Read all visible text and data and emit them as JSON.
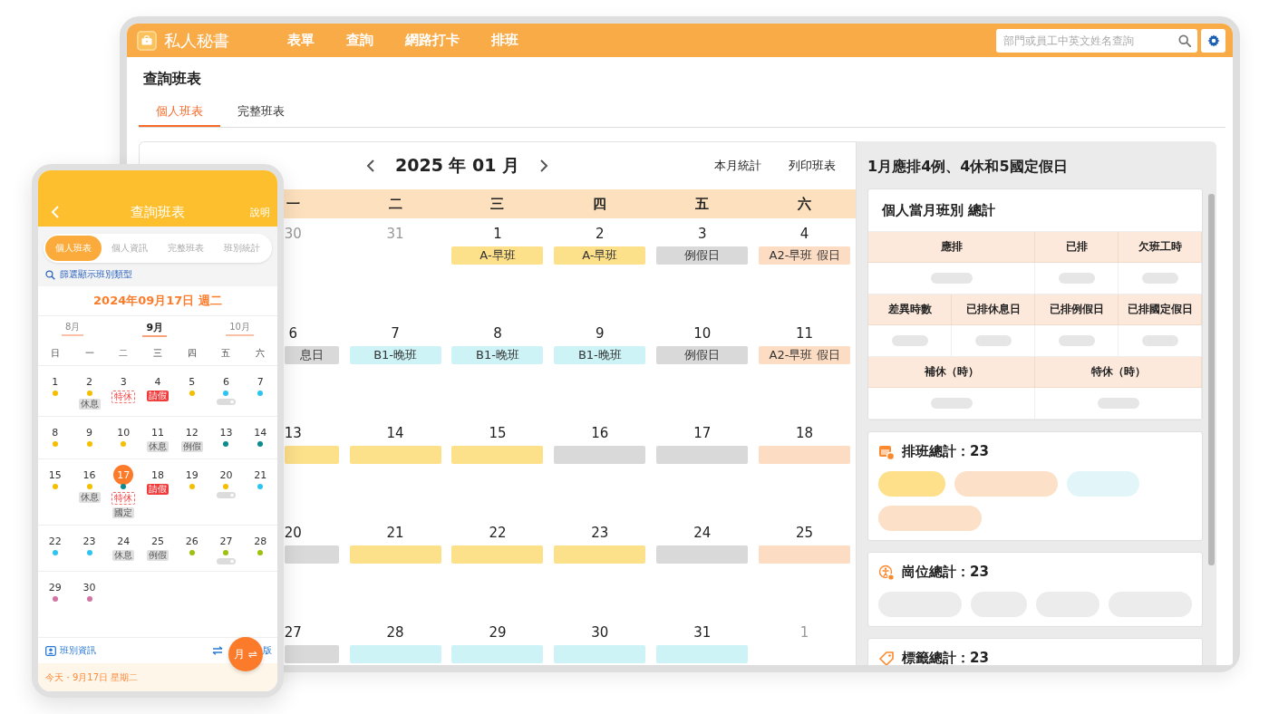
{
  "desktop": {
    "app_title": "私人秘書",
    "nav": [
      "表單",
      "查詢",
      "網路打卡",
      "排班"
    ],
    "search": {
      "placeholder": "部門或員工中英文姓名查詢"
    },
    "page_title": "查詢班表",
    "tabs": [
      {
        "label": "個人班表",
        "selected": true
      },
      {
        "label": "完整班表",
        "selected": false
      }
    ],
    "calendar": {
      "month": "2025 年 01 月",
      "actions": [
        "本月統計",
        "列印班表"
      ],
      "weekdays": [
        "一",
        "二",
        "三",
        "四",
        "五",
        "六"
      ],
      "weeks": [
        [
          {
            "day": "30",
            "other_month": true
          },
          {
            "day": "31",
            "other_month": true
          },
          {
            "day": "1",
            "other_month": false,
            "chip": {
              "text": "A-早班",
              "color": "#fde08a"
            }
          },
          {
            "day": "2",
            "other_month": false,
            "chip": {
              "text": "A-早班",
              "color": "#fde08a"
            }
          },
          {
            "day": "3",
            "other_month": false,
            "chip": {
              "text": "例假日",
              "color": "#d9d9d9"
            }
          },
          {
            "day": "4",
            "other_month": false,
            "chip": {
              "text": "A2-早班 假日",
              "color": "#fddcc4"
            }
          }
        ],
        [
          {
            "day": "6",
            "other_month": false,
            "chip": {
              "text": "息日",
              "color": "#d9d9d9"
            }
          },
          {
            "day": "7",
            "other_month": false,
            "chip": {
              "text": "B1-晚班",
              "color": "#cdf3f7"
            }
          },
          {
            "day": "8",
            "other_month": false,
            "chip": {
              "text": "B1-晚班",
              "color": "#cdf3f7"
            }
          },
          {
            "day": "9",
            "other_month": false,
            "chip": {
              "text": "B1-晚班",
              "color": "#cdf3f7"
            }
          },
          {
            "day": "10",
            "other_month": false,
            "chip": {
              "text": "例假日",
              "color": "#d9d9d9"
            }
          },
          {
            "day": "11",
            "other_month": false,
            "chip": {
              "text": "A2-早班 假日",
              "color": "#fddcc4"
            }
          }
        ],
        [
          {
            "day": "13",
            "other_month": false,
            "chip": {
              "color": "#fde08a"
            }
          },
          {
            "day": "14",
            "other_month": false,
            "chip": {
              "color": "#fde08a"
            }
          },
          {
            "day": "15",
            "other_month": false,
            "chip": {
              "color": "#fde08a"
            }
          },
          {
            "day": "16",
            "other_month": false,
            "chip": {
              "color": "#d9d9d9"
            }
          },
          {
            "day": "17",
            "other_month": false,
            "chip": {
              "color": "#d9d9d9"
            }
          },
          {
            "day": "18",
            "other_month": false,
            "chip": {
              "color": "#fddcc4"
            }
          }
        ],
        [
          {
            "day": "20",
            "other_month": false,
            "chip": {
              "color": "#d9d9d9"
            }
          },
          {
            "day": "21",
            "other_month": false,
            "chip": {
              "color": "#fde08a"
            }
          },
          {
            "day": "22",
            "other_month": false,
            "chip": {
              "color": "#fde08a"
            }
          },
          {
            "day": "23",
            "other_month": false,
            "chip": {
              "color": "#fde08a"
            }
          },
          {
            "day": "24",
            "other_month": false,
            "chip": {
              "color": "#d9d9d9"
            }
          },
          {
            "day": "25",
            "other_month": false,
            "chip": {
              "color": "#fddcc4"
            }
          }
        ],
        [
          {
            "day": "27",
            "other_month": false,
            "chip": {
              "color": "#d9d9d9"
            }
          },
          {
            "day": "28",
            "other_month": false,
            "chip": {
              "color": "#cdf3f7"
            }
          },
          {
            "day": "29",
            "other_month": false,
            "chip": {
              "color": "#cdf3f7"
            }
          },
          {
            "day": "30",
            "other_month": false,
            "chip": {
              "color": "#cdf3f7"
            }
          },
          {
            "day": "31",
            "other_month": false,
            "chip": {
              "color": "#cdf3f7"
            }
          },
          {
            "day": "1",
            "other_month": true
          }
        ]
      ]
    },
    "summary": {
      "headline": "1月應排4例、4休和5國定假日",
      "table": {
        "title": "個人當月班別 總計",
        "groups": [
          [
            "應排",
            "已排",
            "欠班工時"
          ],
          [
            "差異時數",
            "已排休息日",
            "已排例假日",
            "已排國定假日"
          ],
          [
            "補休（時）",
            "特休（時）"
          ]
        ]
      },
      "totals": [
        {
          "kind": "schedule",
          "title": "排班總計：23",
          "pills": [
            {
              "color": "#fee08b"
            },
            {
              "color": "#fde0c8"
            },
            {
              "color": "#e2f6f9"
            },
            {
              "color": "#fde0c8"
            }
          ]
        },
        {
          "kind": "position",
          "title": "崗位總計：23",
          "pills": [
            {
              "color": "#ececec"
            },
            {
              "color": "#ececec"
            },
            {
              "color": "#ececec"
            },
            {
              "color": "#ececec"
            }
          ]
        },
        {
          "kind": "tag",
          "title": "標籤總計：23"
        }
      ]
    }
  },
  "phone": {
    "title": "查詢班表",
    "help": "說明",
    "tabs": [
      {
        "label": "個人班表",
        "selected": true
      },
      {
        "label": "個人資訊",
        "selected": false
      },
      {
        "label": "完整班表",
        "selected": false
      },
      {
        "label": "班別統計",
        "selected": false
      }
    ],
    "filter": "篩選顯示班別類型",
    "date": "2024年09月17日 週二",
    "months": [
      {
        "label": "8月",
        "selected": false
      },
      {
        "label": "9月",
        "selected": true
      },
      {
        "label": "10月",
        "selected": false
      }
    ],
    "weekdays": [
      "日",
      "一",
      "二",
      "三",
      "四",
      "五",
      "六"
    ],
    "weeks": [
      [
        {
          "day": "1",
          "selected": false,
          "marks": [
            {
              "kind": "dot",
              "color": "#f5bf00"
            }
          ]
        },
        {
          "day": "2",
          "selected": false,
          "marks": [
            {
              "kind": "dot",
              "color": "#f5bf00"
            },
            {
              "kind": "tag",
              "text": "休息"
            }
          ]
        },
        {
          "day": "3",
          "selected": false,
          "marks": [
            {
              "kind": "outline-tag",
              "text": "特休"
            }
          ]
        },
        {
          "day": "4",
          "selected": false,
          "marks": [
            {
              "kind": "alert-tag",
              "text": "請假"
            }
          ]
        },
        {
          "day": "5",
          "selected": false,
          "marks": [
            {
              "kind": "dot",
              "color": "#f5bf00"
            }
          ]
        },
        {
          "day": "6",
          "selected": false,
          "marks": [
            {
              "kind": "dot",
              "color": "#2ec4f0"
            },
            {
              "kind": "bar"
            }
          ]
        },
        {
          "day": "7",
          "selected": false,
          "marks": [
            {
              "kind": "dot",
              "color": "#2ec4f0"
            }
          ]
        }
      ],
      [
        {
          "day": "8",
          "selected": false,
          "marks": [
            {
              "kind": "dot",
              "color": "#f5bf00"
            }
          ]
        },
        {
          "day": "9",
          "selected": false,
          "marks": [
            {
              "kind": "dot",
              "color": "#f5bf00"
            }
          ]
        },
        {
          "day": "10",
          "selected": false,
          "marks": [
            {
              "kind": "dot",
              "color": "#f5bf00"
            }
          ]
        },
        {
          "day": "11",
          "selected": false,
          "marks": [
            {
              "kind": "tag",
              "text": "休息"
            }
          ]
        },
        {
          "day": "12",
          "selected": false,
          "marks": [
            {
              "kind": "tag",
              "text": "例假"
            }
          ]
        },
        {
          "day": "13",
          "selected": false,
          "marks": [
            {
              "kind": "dot",
              "color": "#0b8a8f"
            }
          ]
        },
        {
          "day": "14",
          "selected": false,
          "marks": [
            {
              "kind": "dot",
              "color": "#0b8a8f"
            }
          ]
        }
      ],
      [
        {
          "day": "15",
          "selected": false,
          "marks": [
            {
              "kind": "dot",
              "color": "#f5bf00"
            }
          ]
        },
        {
          "day": "16",
          "selected": false,
          "marks": [
            {
              "kind": "dot",
              "color": "#f5bf00"
            },
            {
              "kind": "tag",
              "text": "休息"
            }
          ]
        },
        {
          "day": "17",
          "selected": true,
          "marks": [
            {
              "kind": "dot",
              "color": "#0b8a8f"
            },
            {
              "kind": "outline-tag",
              "text": "特休"
            },
            {
              "kind": "tag",
              "text": "國定"
            }
          ]
        },
        {
          "day": "18",
          "selected": false,
          "marks": [
            {
              "kind": "alert-tag",
              "text": "請假"
            }
          ]
        },
        {
          "day": "19",
          "selected": false,
          "marks": [
            {
              "kind": "dot",
              "color": "#f5bf00"
            }
          ]
        },
        {
          "day": "20",
          "selected": false,
          "marks": [
            {
              "kind": "dot",
              "color": "#f5bf00"
            },
            {
              "kind": "bar"
            }
          ]
        },
        {
          "day": "21",
          "selected": false,
          "marks": [
            {
              "kind": "dot",
              "color": "#2ec4f0"
            }
          ]
        }
      ],
      [
        {
          "day": "22",
          "selected": false,
          "marks": [
            {
              "kind": "dot",
              "color": "#2ec4f0"
            }
          ]
        },
        {
          "day": "23",
          "selected": false,
          "marks": [
            {
              "kind": "dot",
              "color": "#2ec4f0"
            }
          ]
        },
        {
          "day": "24",
          "selected": false,
          "marks": [
            {
              "kind": "tag",
              "text": "休息"
            }
          ]
        },
        {
          "day": "25",
          "selected": false,
          "marks": [
            {
              "kind": "tag",
              "text": "例假"
            }
          ]
        },
        {
          "day": "26",
          "selected": false,
          "marks": [
            {
              "kind": "dot",
              "color": "#9cc20e"
            }
          ]
        },
        {
          "day": "27",
          "selected": false,
          "marks": [
            {
              "kind": "dot",
              "color": "#9cc20e"
            },
            {
              "kind": "bar"
            }
          ]
        },
        {
          "day": "28",
          "selected": false,
          "marks": [
            {
              "kind": "dot",
              "color": "#9cc20e"
            }
          ]
        }
      ],
      [
        {
          "day": "29",
          "selected": false,
          "marks": [
            {
              "kind": "dot",
              "color": "#d173a3"
            }
          ]
        },
        {
          "day": "30",
          "selected": false,
          "marks": [
            {
              "kind": "dot",
              "color": "#d173a3"
            }
          ]
        }
      ]
    ],
    "info_link": "班別資訊",
    "switch_link": "版",
    "fab": "月 ⇌",
    "today": "今天・9月17日 星期二"
  }
}
